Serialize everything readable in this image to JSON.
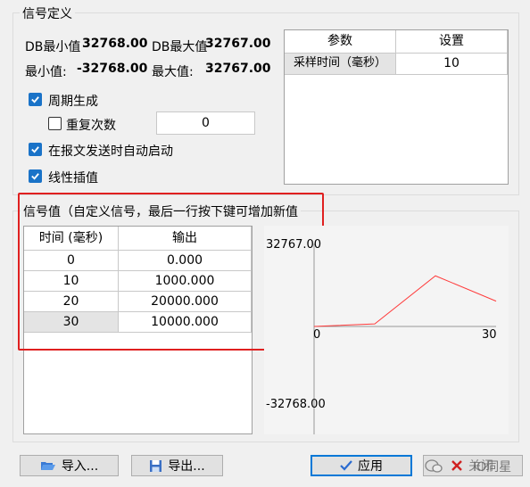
{
  "signal_group": {
    "title": "信号定义",
    "db_min_label": "DB最小值",
    "db_min_value": "32768.00",
    "db_max_label": "DB最大值",
    "db_max_value": "32767.00",
    "min_label": "最小值:",
    "min_value": "-32768.00",
    "max_label": "最大值:",
    "max_value": "32767.00",
    "periodic_label": "周期生成",
    "periodic_checked": true,
    "repeat_label": "重复次数",
    "repeat_checked": false,
    "repeat_value": "0",
    "autostart_label": "在报文发送时自动启动",
    "autostart_checked": true,
    "interp_label": "线性插值",
    "interp_checked": true
  },
  "param_table": {
    "headers": [
      "参数",
      "设置"
    ],
    "rows": [
      [
        "采样时间（毫秒）",
        "10"
      ]
    ]
  },
  "signal_values": {
    "title": "信号值（自定义信号，最后一行按下键可增加新值",
    "headers": [
      "时间 (毫秒)",
      "输出"
    ],
    "rows": [
      [
        "0",
        "0.000"
      ],
      [
        "10",
        "1000.000"
      ],
      [
        "20",
        "20000.000"
      ],
      [
        "30",
        "10000.000"
      ]
    ]
  },
  "chart_data": {
    "type": "line",
    "x": [
      0,
      10,
      20,
      30
    ],
    "series": [
      {
        "values": [
          0,
          1000,
          20000,
          10000
        ]
      }
    ],
    "y_top_label": "32767.00",
    "y_bottom_label": "-32768.00",
    "x_start_label": "0",
    "x_end_label": "30",
    "ylim": [
      -32768,
      32767
    ],
    "xlim": [
      0,
      30
    ],
    "line_color": "#ff3b3b"
  },
  "buttons": {
    "import_label": "导入...",
    "export_label": "导出...",
    "apply_label": "应用",
    "close_label": "关闭"
  },
  "watermark": "IO同星",
  "colors": {
    "highlight_border": "#e02020",
    "checkbox_blue": "#1a73c8"
  }
}
